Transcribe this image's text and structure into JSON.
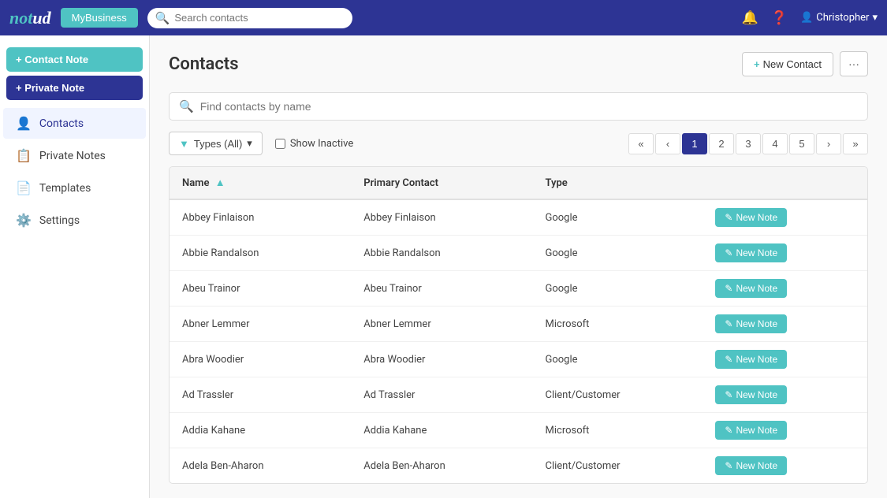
{
  "topnav": {
    "logo": "notud",
    "mybusiness_label": "MyBusiness",
    "search_placeholder": "Search contacts",
    "user_name": "Christopher"
  },
  "sidebar": {
    "btn_contact_note": "+ Contact Note",
    "btn_private_note": "+ Private Note",
    "nav_items": [
      {
        "id": "contacts",
        "label": "Contacts",
        "icon": "👤",
        "active": true
      },
      {
        "id": "private-notes",
        "label": "Private Notes",
        "icon": "📋",
        "active": false
      },
      {
        "id": "templates",
        "label": "Templates",
        "icon": "📄",
        "active": false
      },
      {
        "id": "settings",
        "label": "Settings",
        "icon": "⚙️",
        "active": false
      }
    ]
  },
  "main": {
    "page_title": "Contacts",
    "new_contact_label": "New Contact",
    "more_label": "···",
    "search_placeholder": "Find contacts by name",
    "filter_types_label": "Types (All)",
    "show_inactive_label": "Show Inactive",
    "pagination": {
      "first": "«",
      "prev": "‹",
      "next": "›",
      "last": "»",
      "pages": [
        "1",
        "2",
        "3",
        "4",
        "5"
      ],
      "active_page": "1"
    },
    "table_headers": [
      "Name",
      "Primary Contact",
      "Type",
      ""
    ],
    "table_rows": [
      {
        "name": "Abbey Finlaison",
        "primary_contact": "Abbey Finlaison",
        "type": "Google"
      },
      {
        "name": "Abbie Randalson",
        "primary_contact": "Abbie Randalson",
        "type": "Google"
      },
      {
        "name": "Abeu Trainor",
        "primary_contact": "Abeu Trainor",
        "type": "Google"
      },
      {
        "name": "Abner Lemmer",
        "primary_contact": "Abner Lemmer",
        "type": "Microsoft"
      },
      {
        "name": "Abra Woodier",
        "primary_contact": "Abra Woodier",
        "type": "Google"
      },
      {
        "name": "Ad Trassler",
        "primary_contact": "Ad Trassler",
        "type": "Client/Customer"
      },
      {
        "name": "Addia Kahane",
        "primary_contact": "Addia Kahane",
        "type": "Microsoft"
      },
      {
        "name": "Adela Ben-Aharon",
        "primary_contact": "Adela Ben-Aharon",
        "type": "Client/Customer"
      }
    ],
    "new_note_btn_label": "New Note"
  }
}
